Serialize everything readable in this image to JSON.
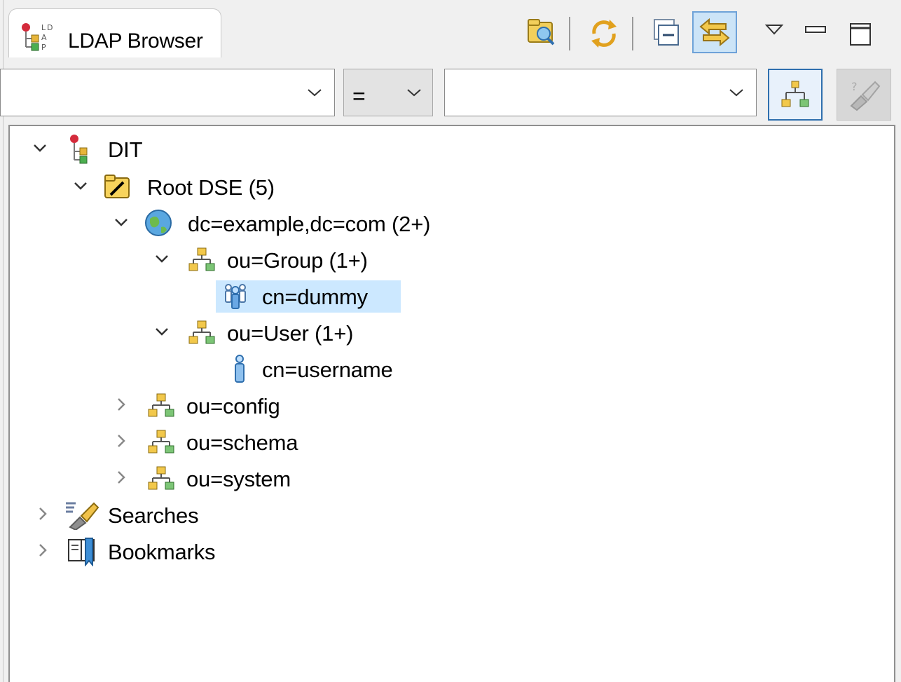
{
  "view": {
    "title": "LDAP Browser",
    "icon": "ldap-browser-icon"
  },
  "toolbar": {
    "items": [
      {
        "name": "open-search-dialog-icon"
      },
      {
        "name": "refresh-icon"
      },
      {
        "name": "collapse-all-icon"
      },
      {
        "name": "link-with-editor-icon",
        "active": true
      },
      {
        "name": "view-menu-icon"
      },
      {
        "name": "minimize-icon"
      },
      {
        "name": "maximize-icon"
      }
    ]
  },
  "filter": {
    "attribute_value": "",
    "operator_value": "=",
    "value_value": "",
    "buttons": [
      {
        "name": "apply-filter-icon"
      },
      {
        "name": "clear-filter-icon",
        "disabled": true
      }
    ]
  },
  "colors": {
    "selection": "#cce8ff",
    "accent": "#4a8ed8",
    "tree_bg": "#ffffff"
  },
  "tree": [
    {
      "label": "DIT",
      "icon": "dit-icon",
      "expanded": true
    },
    {
      "label": "Root DSE (5)",
      "icon": "root-dse-icon",
      "expanded": true
    },
    {
      "label": "dc=example,dc=com (2+)",
      "icon": "globe-icon",
      "expanded": true
    },
    {
      "label": "ou=Group (1+)",
      "icon": "org-unit-icon",
      "expanded": true
    },
    {
      "label": "cn=dummy",
      "icon": "group-icon",
      "selected": true
    },
    {
      "label": "ou=User (1+)",
      "icon": "org-unit-icon",
      "expanded": true
    },
    {
      "label": "cn=username",
      "icon": "person-icon"
    },
    {
      "label": "ou=config",
      "icon": "org-unit-icon",
      "expanded": false
    },
    {
      "label": "ou=schema",
      "icon": "org-unit-icon",
      "expanded": false
    },
    {
      "label": "ou=system",
      "icon": "org-unit-icon",
      "expanded": false
    },
    {
      "label": "Searches",
      "icon": "searches-icon",
      "expanded": false
    },
    {
      "label": "Bookmarks",
      "icon": "bookmarks-icon",
      "expanded": false
    }
  ]
}
